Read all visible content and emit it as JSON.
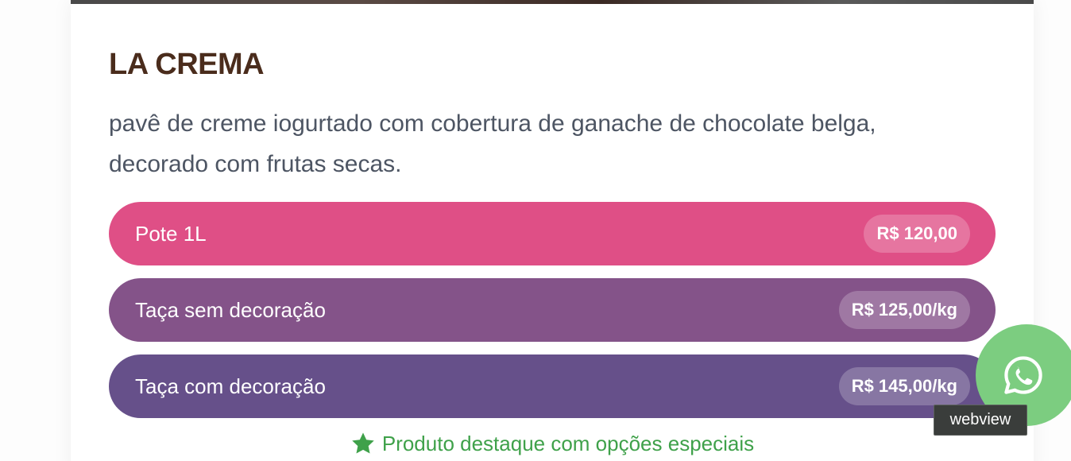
{
  "product": {
    "title": "LA CREMA",
    "description": "pavê de creme iogurtado com cobertura de ganache de chocolate belga, decorado com frutas secas."
  },
  "options": [
    {
      "label": "Pote 1L",
      "price": "R$ 120,00",
      "color": "#df4f86"
    },
    {
      "label": "Taça sem decoração",
      "price": "R$ 125,00/kg",
      "color": "#845389"
    },
    {
      "label": "Taça com decoração",
      "price": "R$ 145,00/kg",
      "color": "#66508a"
    }
  ],
  "featured": {
    "icon": "star-icon",
    "text": "Produto destaque com opções especiais",
    "color": "#3fa14a"
  },
  "whatsapp": {
    "icon": "whatsapp-icon",
    "color": "#7ccd80",
    "tooltip": "webview"
  }
}
